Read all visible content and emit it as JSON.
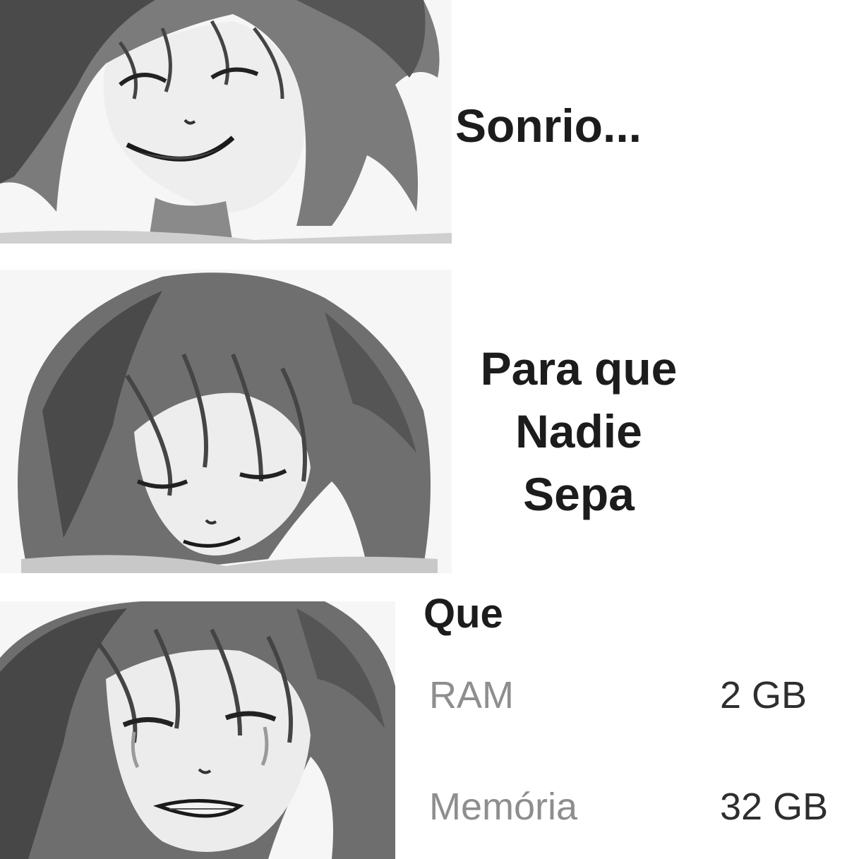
{
  "captions": {
    "first": "Sonrio...",
    "second_lines": [
      "Para que",
      "Nadie",
      "Sepa"
    ],
    "third": "Que"
  },
  "specs": [
    {
      "label": "RAM",
      "value": "2 GB"
    },
    {
      "label": "Memória",
      "value": "32 GB"
    }
  ],
  "panels": [
    {
      "expression": "smiling"
    },
    {
      "expression": "sad-smile"
    },
    {
      "expression": "crying"
    }
  ],
  "colors": {
    "background": "#ffffff",
    "caption_text": "#1c1c1c",
    "spec_label": "#8e8e8e",
    "spec_value": "#2e2e2e",
    "sketch_dark": "#3a3a3a",
    "sketch_mid": "#7a7a7a"
  }
}
